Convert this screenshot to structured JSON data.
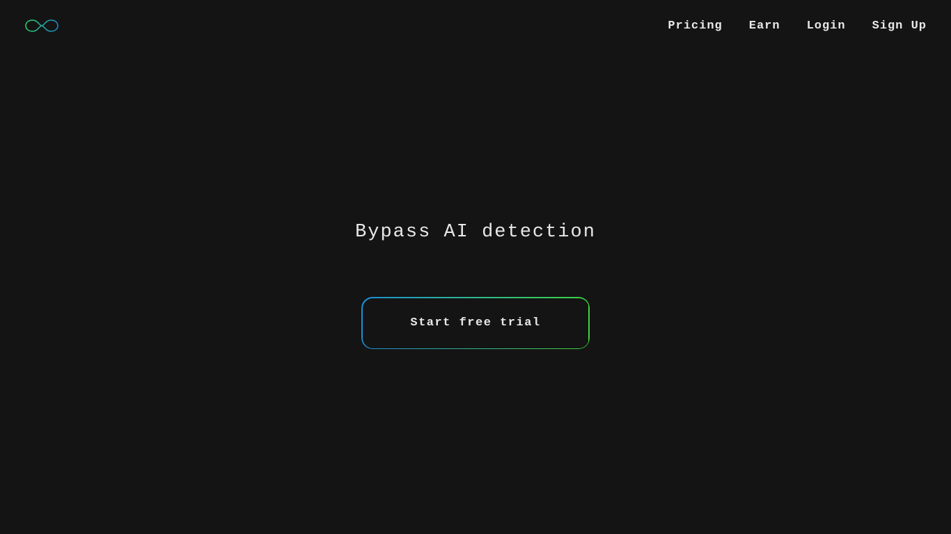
{
  "nav": {
    "pricing": "Pricing",
    "earn": "Earn",
    "login": "Login",
    "signup": "Sign Up"
  },
  "hero": {
    "title": "Bypass AI detection",
    "cta_label": "Start free trial"
  },
  "logo": {
    "name": "infinity-logo",
    "gradient_start": "#2fd66e",
    "gradient_end": "#1b8fd6"
  }
}
